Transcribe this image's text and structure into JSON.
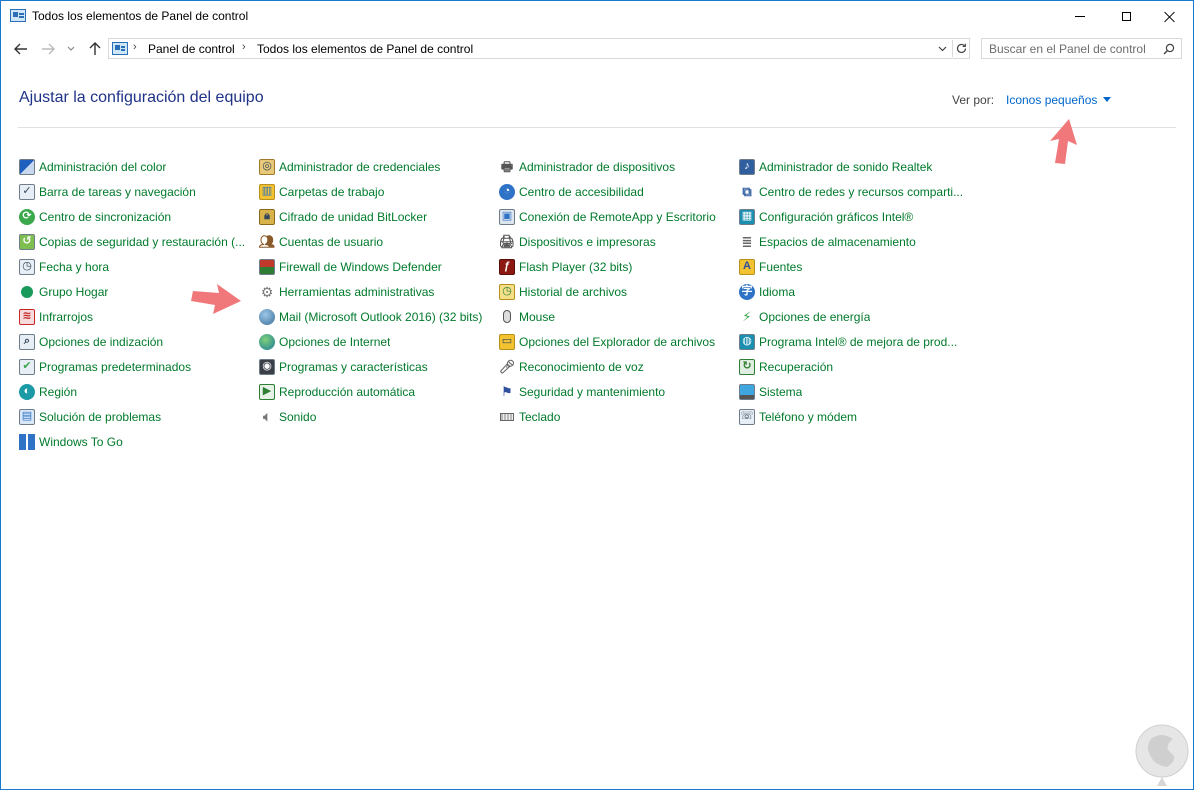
{
  "window": {
    "title": "Todos los elementos de Panel de control"
  },
  "navigation": {
    "back_icon": "arrow-left-icon",
    "forward_icon": "arrow-right-icon",
    "recent_icon": "chevron-down-icon",
    "up_icon": "arrow-up-icon",
    "breadcrumbs": [
      "Panel de control",
      "Todos los elementos de Panel de control"
    ],
    "search_placeholder": "Buscar en el Panel de control"
  },
  "header": {
    "title": "Ajustar la configuración del equipo",
    "view_by_label": "Ver por:",
    "view_by_value": "Iconos pequeños"
  },
  "columns": [
    {
      "items": [
        {
          "label": "Administración del color",
          "icon": "color-management-icon"
        },
        {
          "label": "Barra de tareas y navegación",
          "icon": "taskbar-icon"
        },
        {
          "label": "Centro de sincronización",
          "icon": "sync-center-icon"
        },
        {
          "label": "Copias de seguridad y restauración (...",
          "icon": "backup-restore-icon"
        },
        {
          "label": "Fecha y hora",
          "icon": "date-time-icon"
        },
        {
          "label": "Grupo Hogar",
          "icon": "homegroup-icon"
        },
        {
          "label": "Infrarrojos",
          "icon": "infrared-icon"
        },
        {
          "label": "Opciones de indización",
          "icon": "indexing-options-icon"
        },
        {
          "label": "Programas predeterminados",
          "icon": "default-programs-icon"
        },
        {
          "label": "Región",
          "icon": "region-icon"
        },
        {
          "label": "Solución de problemas",
          "icon": "troubleshooting-icon"
        },
        {
          "label": "Windows To Go",
          "icon": "windows-to-go-icon"
        }
      ]
    },
    {
      "items": [
        {
          "label": "Administrador de credenciales",
          "icon": "credential-manager-icon"
        },
        {
          "label": "Carpetas de trabajo",
          "icon": "work-folders-icon"
        },
        {
          "label": "Cifrado de unidad BitLocker",
          "icon": "bitlocker-icon"
        },
        {
          "label": "Cuentas de usuario",
          "icon": "user-accounts-icon"
        },
        {
          "label": "Firewall de Windows Defender",
          "icon": "firewall-icon"
        },
        {
          "label": "Herramientas administrativas",
          "icon": "admin-tools-icon"
        },
        {
          "label": "Mail (Microsoft Outlook 2016) (32 bits)",
          "icon": "mail-icon"
        },
        {
          "label": "Opciones de Internet",
          "icon": "internet-options-icon"
        },
        {
          "label": "Programas y características",
          "icon": "programs-features-icon"
        },
        {
          "label": "Reproducción automática",
          "icon": "autoplay-icon"
        },
        {
          "label": "Sonido",
          "icon": "sound-icon"
        }
      ]
    },
    {
      "items": [
        {
          "label": "Administrador de dispositivos",
          "icon": "device-manager-icon"
        },
        {
          "label": "Centro de accesibilidad",
          "icon": "ease-of-access-icon"
        },
        {
          "label": "Conexión de RemoteApp y Escritorio",
          "icon": "remoteapp-icon"
        },
        {
          "label": "Dispositivos e impresoras",
          "icon": "devices-printers-icon"
        },
        {
          "label": "Flash Player (32 bits)",
          "icon": "flash-player-icon"
        },
        {
          "label": "Historial de archivos",
          "icon": "file-history-icon"
        },
        {
          "label": "Mouse",
          "icon": "mouse-icon"
        },
        {
          "label": "Opciones del Explorador de archivos",
          "icon": "explorer-options-icon"
        },
        {
          "label": "Reconocimiento de voz",
          "icon": "speech-recognition-icon"
        },
        {
          "label": "Seguridad y mantenimiento",
          "icon": "security-maintenance-icon"
        },
        {
          "label": "Teclado",
          "icon": "keyboard-icon"
        }
      ]
    },
    {
      "items": [
        {
          "label": "Administrador de sonido Realtek",
          "icon": "realtek-audio-icon"
        },
        {
          "label": "Centro de redes y recursos comparti...",
          "icon": "network-sharing-icon"
        },
        {
          "label": "Configuración gráficos Intel®",
          "icon": "intel-graphics-icon"
        },
        {
          "label": "Espacios de almacenamiento",
          "icon": "storage-spaces-icon"
        },
        {
          "label": "Fuentes",
          "icon": "fonts-icon"
        },
        {
          "label": "Idioma",
          "icon": "language-icon"
        },
        {
          "label": "Opciones de energía",
          "icon": "power-options-icon"
        },
        {
          "label": "Programa Intel® de mejora de prod...",
          "icon": "intel-program-icon"
        },
        {
          "label": "Recuperación",
          "icon": "recovery-icon"
        },
        {
          "label": "Sistema",
          "icon": "system-icon"
        },
        {
          "label": "Teléfono y módem",
          "icon": "phone-modem-icon"
        }
      ]
    }
  ],
  "colors": {
    "link_green": "#007a2b",
    "heading_blue": "#1e3287",
    "view_by_blue": "#0066cc",
    "annotation_pink": "#f0787a"
  }
}
